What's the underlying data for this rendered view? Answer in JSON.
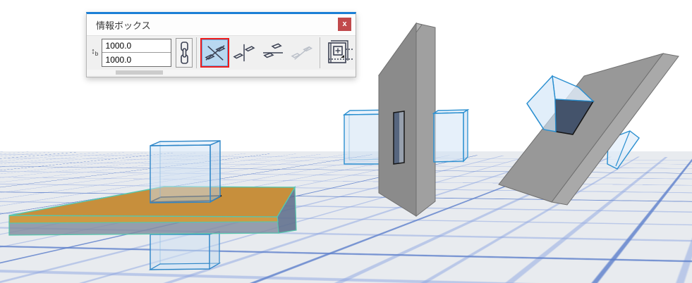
{
  "palette": {
    "title": "情報ボックス",
    "close_glyph": "x",
    "height_icon_arrow": "↕",
    "height_icon_sub": "b",
    "inputs": {
      "top_value": "1000.0",
      "bottom_value": "1000.0"
    },
    "buttons": {
      "link": "chain-link",
      "tools": [
        {
          "name": "intersection-cross",
          "state": "selected"
        },
        {
          "name": "mirror-vertical-plane",
          "state": "normal"
        },
        {
          "name": "mirror-horizontal-plane",
          "state": "normal"
        },
        {
          "name": "mirror-diagonal-plane",
          "state": "disabled"
        }
      ],
      "settings": "element-settings-dialog"
    },
    "colors": {
      "top_border": "#1b7fd6",
      "close_bg": "#c1494c",
      "selected_tool_bg": "#b9d8f0",
      "selected_tool_border": "#ee1c1c"
    }
  },
  "scene": {
    "objects": [
      "slab-with-vertical-box",
      "wall-with-horizontal-box",
      "slanted-panel-with-box"
    ],
    "colors": {
      "sky": "#ffffff",
      "ground": "#e8ebef",
      "grid_major": "#5a7dc8",
      "grid_minor": "#8ca5e1",
      "box_edge": "#2e86c8",
      "box_fill": "#d6e6f6",
      "wall_front": "#8b8b8b",
      "wall_side": "#a0a0a0",
      "slab_top": "#c78f3c",
      "slab_band": "#cf9a43",
      "slab_core": "#8791a4",
      "selection_teal": "#57c7ad",
      "intersection_dark": "#44536b",
      "intersection_outline": "#1c1c1c"
    }
  }
}
